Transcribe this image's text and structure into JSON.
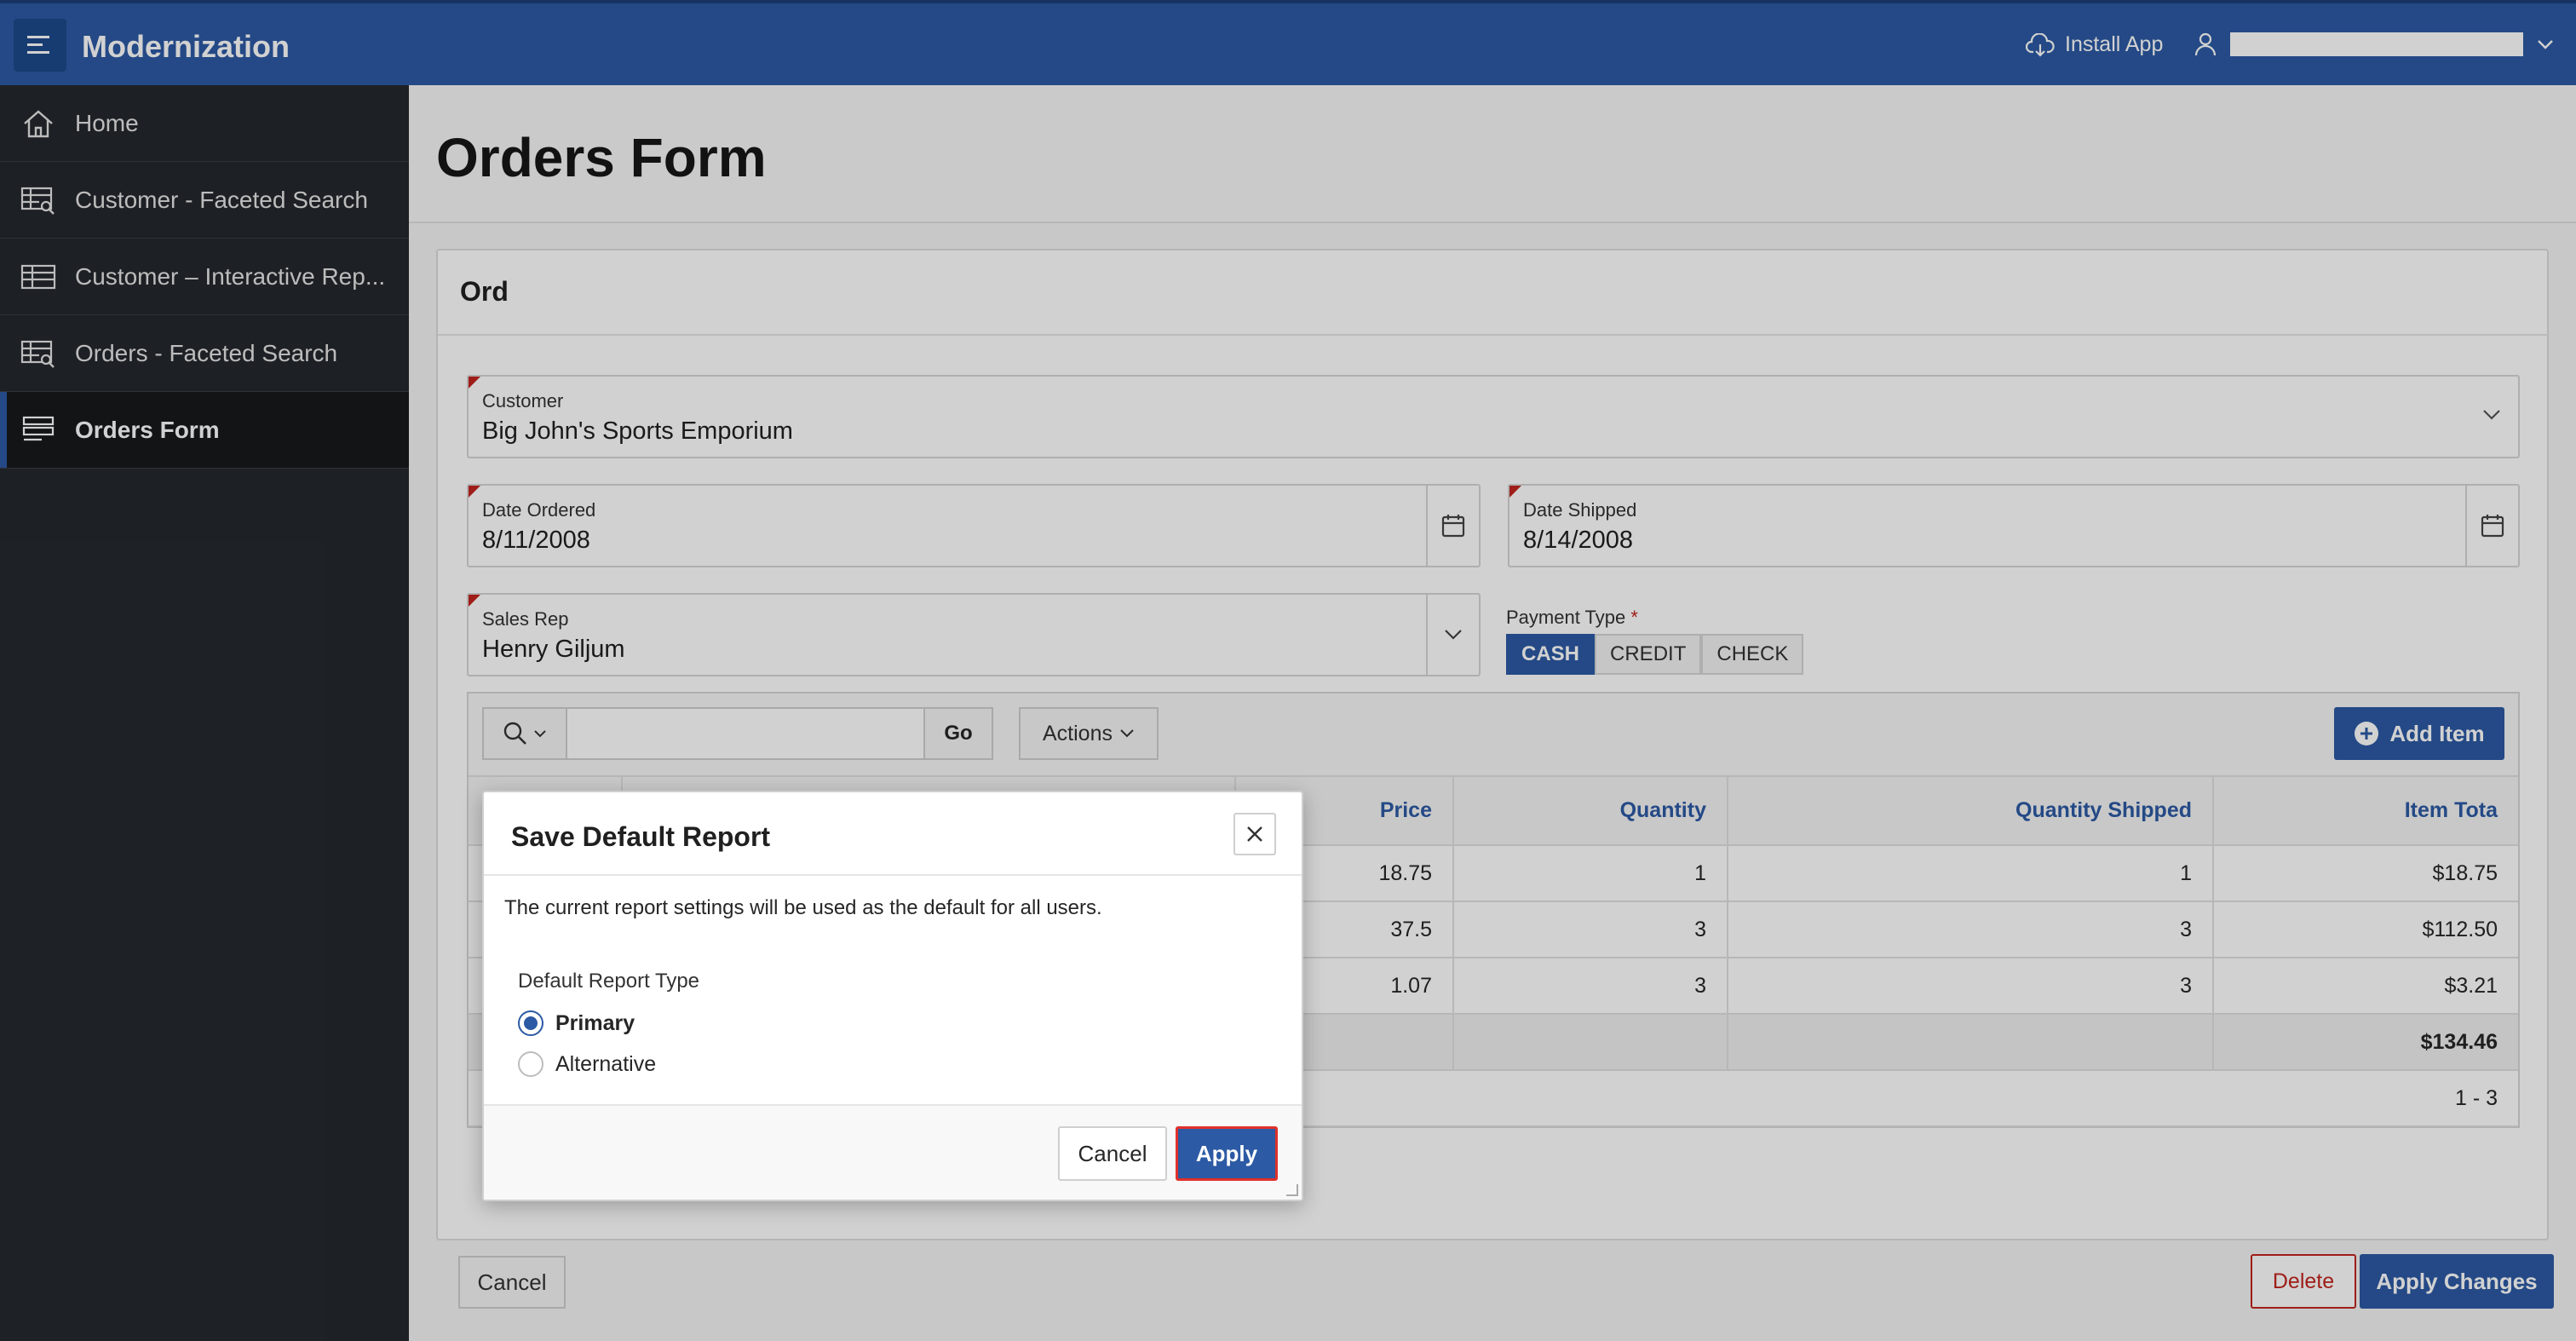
{
  "header": {
    "app_title": "Modernization",
    "install_label": "Install App"
  },
  "sidebar": {
    "items": [
      {
        "label": "Home",
        "icon": "home-icon"
      },
      {
        "label": "Customer - Faceted Search",
        "icon": "table-search-icon"
      },
      {
        "label": "Customer – Interactive Rep...",
        "icon": "table-icon"
      },
      {
        "label": "Orders - Faceted Search",
        "icon": "table-search-icon"
      },
      {
        "label": "Orders Form",
        "icon": "form-icon",
        "active": true
      }
    ]
  },
  "page": {
    "title": "Orders Form",
    "region_title": "Ord"
  },
  "form": {
    "customer_label": "Customer",
    "customer_value": "Big John's Sports Emporium",
    "date_ordered_label": "Date Ordered",
    "date_ordered_value": "8/11/2008",
    "date_shipped_label": "Date Shipped",
    "date_shipped_value": "8/14/2008",
    "sales_rep_label": "Sales Rep",
    "sales_rep_value": "Henry Giljum",
    "payment_type_label": "Payment Type",
    "payment_required_mark": "*",
    "payment_options": [
      "CASH",
      "CREDIT",
      "CHECK"
    ],
    "payment_selected": "CASH"
  },
  "grid": {
    "go_label": "Go",
    "actions_label": "Actions",
    "add_item_label": "Add Item",
    "columns": [
      "Price",
      "Quantity",
      "Quantity Shipped",
      "Item Tota"
    ],
    "rows": [
      [
        "18.75",
        "1",
        "1",
        "$18.75"
      ],
      [
        "37.5",
        "3",
        "3",
        "$112.50"
      ],
      [
        "1.07",
        "3",
        "3",
        "$3.21"
      ]
    ],
    "total": "$134.46",
    "pagination": "1 - 3"
  },
  "buttons": {
    "cancel_label": "Cancel",
    "delete_label": "Delete",
    "apply_changes_label": "Apply Changes"
  },
  "dialog": {
    "title": "Save Default Report",
    "description": "The current report settings will be used as the default for all users.",
    "type_label": "Default Report Type",
    "options": [
      "Primary",
      "Alternative"
    ],
    "selected": "Primary",
    "cancel_label": "Cancel",
    "apply_label": "Apply"
  },
  "colors": {
    "brand": "#2c5aa4",
    "sidebar": "#24282d",
    "required": "#c2241e",
    "highlight": "#e0312a"
  }
}
